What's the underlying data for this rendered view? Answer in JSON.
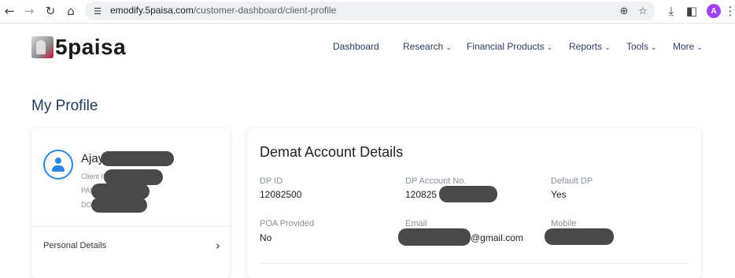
{
  "browser": {
    "url_host": "emodify.5paisa.com",
    "url_path": "/customer-dashboard/client-profile",
    "avatar_letter": "A"
  },
  "site": {
    "logo_text": "5paisa",
    "nav": [
      {
        "label": "Dashboard",
        "has_dropdown": false
      },
      {
        "label": "Research",
        "has_dropdown": true
      },
      {
        "label": "Financial Products",
        "has_dropdown": true
      },
      {
        "label": "Reports",
        "has_dropdown": true
      },
      {
        "label": "Tools",
        "has_dropdown": true
      },
      {
        "label": "More",
        "has_dropdown": true
      }
    ],
    "page_title": "My Profile"
  },
  "profile_card": {
    "name": "Ajay",
    "client_id_label": "Client ID",
    "pan_label": "PAN",
    "dob_label": "DOB",
    "menu_item": "Personal Details"
  },
  "demat": {
    "title": "Demat Account Details",
    "fields": [
      {
        "label": "DP ID",
        "value": "12082500"
      },
      {
        "label": "DP Account No.",
        "value": "120825"
      },
      {
        "label": "Default DP",
        "value": "Yes"
      },
      {
        "label": "POA Provided",
        "value": "No"
      },
      {
        "label": "Email",
        "value": "@gmail.com"
      },
      {
        "label": "Mobile",
        "value": ""
      }
    ]
  },
  "colors": {
    "accent": "#2b87e3",
    "nav_text": "#2c3e66",
    "title_text": "#1f3a5f",
    "redaction": "#4a4a4a"
  }
}
